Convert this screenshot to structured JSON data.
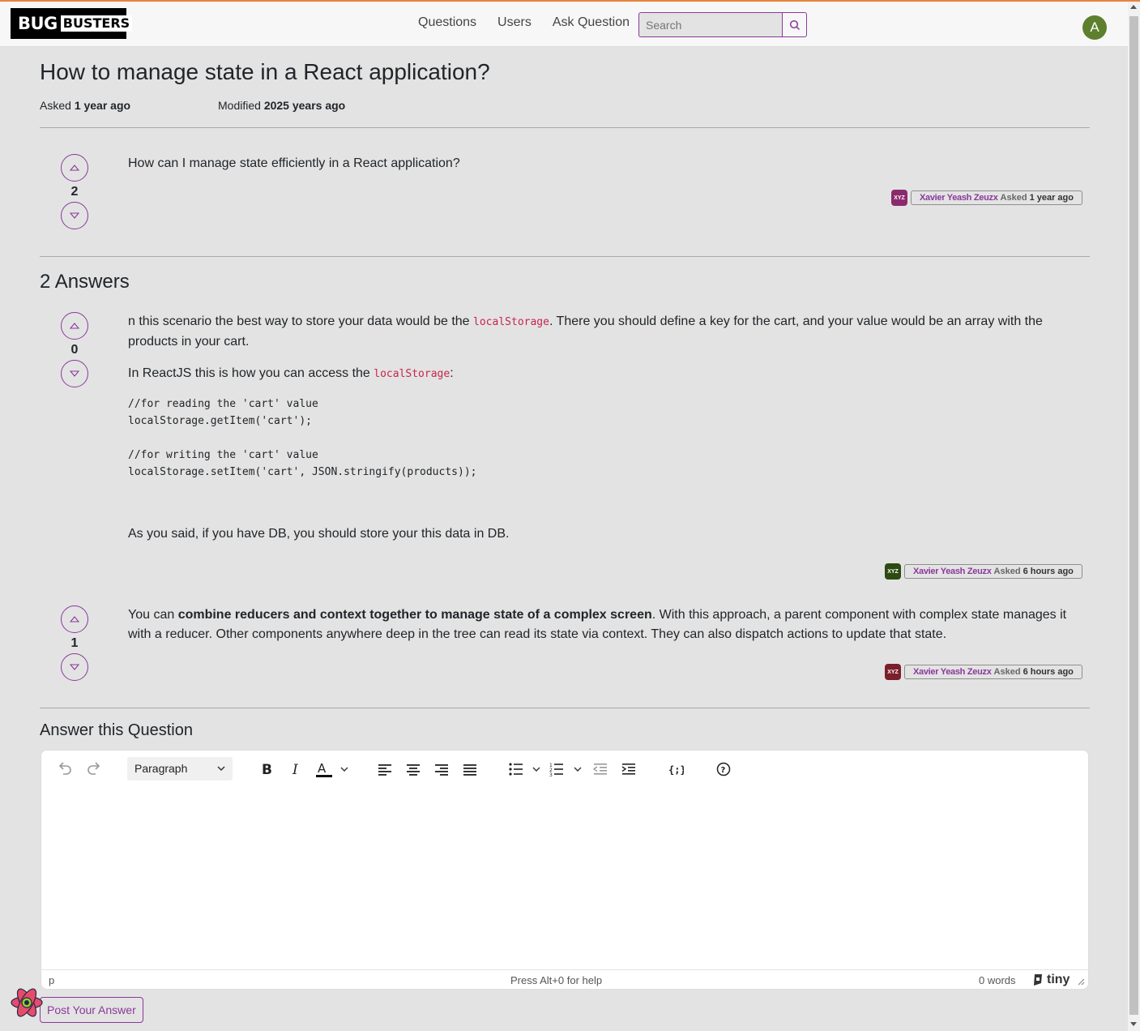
{
  "brand": {
    "logo_left": "BUG",
    "logo_right": "BUSTERS"
  },
  "nav": {
    "questions": "Questions",
    "users": "Users",
    "ask": "Ask Question",
    "search_placeholder": "Search",
    "user_initial": "A"
  },
  "question": {
    "title": "How to manage state in a React application?",
    "asked_label": "Asked",
    "asked_value": "1 year ago",
    "modified_label": "Modified",
    "modified_value": "2025 years ago",
    "body": "How can I manage state efficiently in a React application?",
    "votes": "2",
    "author": {
      "initials": "XYZ",
      "name": "Xavier Yeash Zeuzx",
      "asked": "Asked",
      "time": "1 year ago",
      "color": "#8b2b6e"
    }
  },
  "answers_heading": "2 Answers",
  "answers": [
    {
      "votes": "0",
      "p1_a": "n this scenario the best way to store your data would be the ",
      "p1_code": "localStorage",
      "p1_b": ". There you should define a key for the cart, and your value would be an array with the products in your cart.",
      "p2_a": "In ReactJS this is how you can access the ",
      "p2_code": "localStorage",
      "p2_b": ":",
      "code": "//for reading the 'cart' value\nlocalStorage.getItem('cart');\n\n//for writing the 'cart' value\nlocalStorage.setItem('cart', JSON.stringify(products));",
      "p3": "As you said, if you have DB, you should store your this data in DB.",
      "author": {
        "initials": "XYZ",
        "name": "Xavier Yeash Zeuzx",
        "asked": "Asked",
        "time": "6 hours ago",
        "color": "#2d4a12"
      }
    },
    {
      "votes": "1",
      "p1_a": "You can ",
      "p1_bold": "combine reducers and context together to manage state of a complex screen",
      "p1_b": ". With this approach, a parent component with complex state manages it with a reducer. Other components anywhere deep in the tree can read its state via context. They can also dispatch actions to update that state.",
      "author": {
        "initials": "XYZ",
        "name": "Xavier Yeash Zeuzx",
        "asked": "Asked",
        "time": "6 hours ago",
        "color": "#7a1f2b"
      }
    }
  ],
  "answer_form": {
    "heading": "Answer this Question",
    "format": "Paragraph",
    "status_path": "p",
    "status_help": "Press Alt+0 for help",
    "status_words": "0 words",
    "tiny_brand": "tiny",
    "post_button": "Post Your Answer"
  },
  "colors": {
    "accent": "#8a3a9a",
    "code": "#c7254e",
    "background": "#e3e3e3"
  },
  "icons": [
    "search-icon",
    "upvote-icon",
    "downvote-icon",
    "undo-icon",
    "redo-icon",
    "bold-icon",
    "italic-icon",
    "text-color-icon",
    "align-left-icon",
    "align-center-icon",
    "align-right-icon",
    "align-justify-icon",
    "bullet-list-icon",
    "numbered-list-icon",
    "outdent-icon",
    "indent-icon",
    "code-sample-icon",
    "help-icon",
    "react-icon"
  ]
}
